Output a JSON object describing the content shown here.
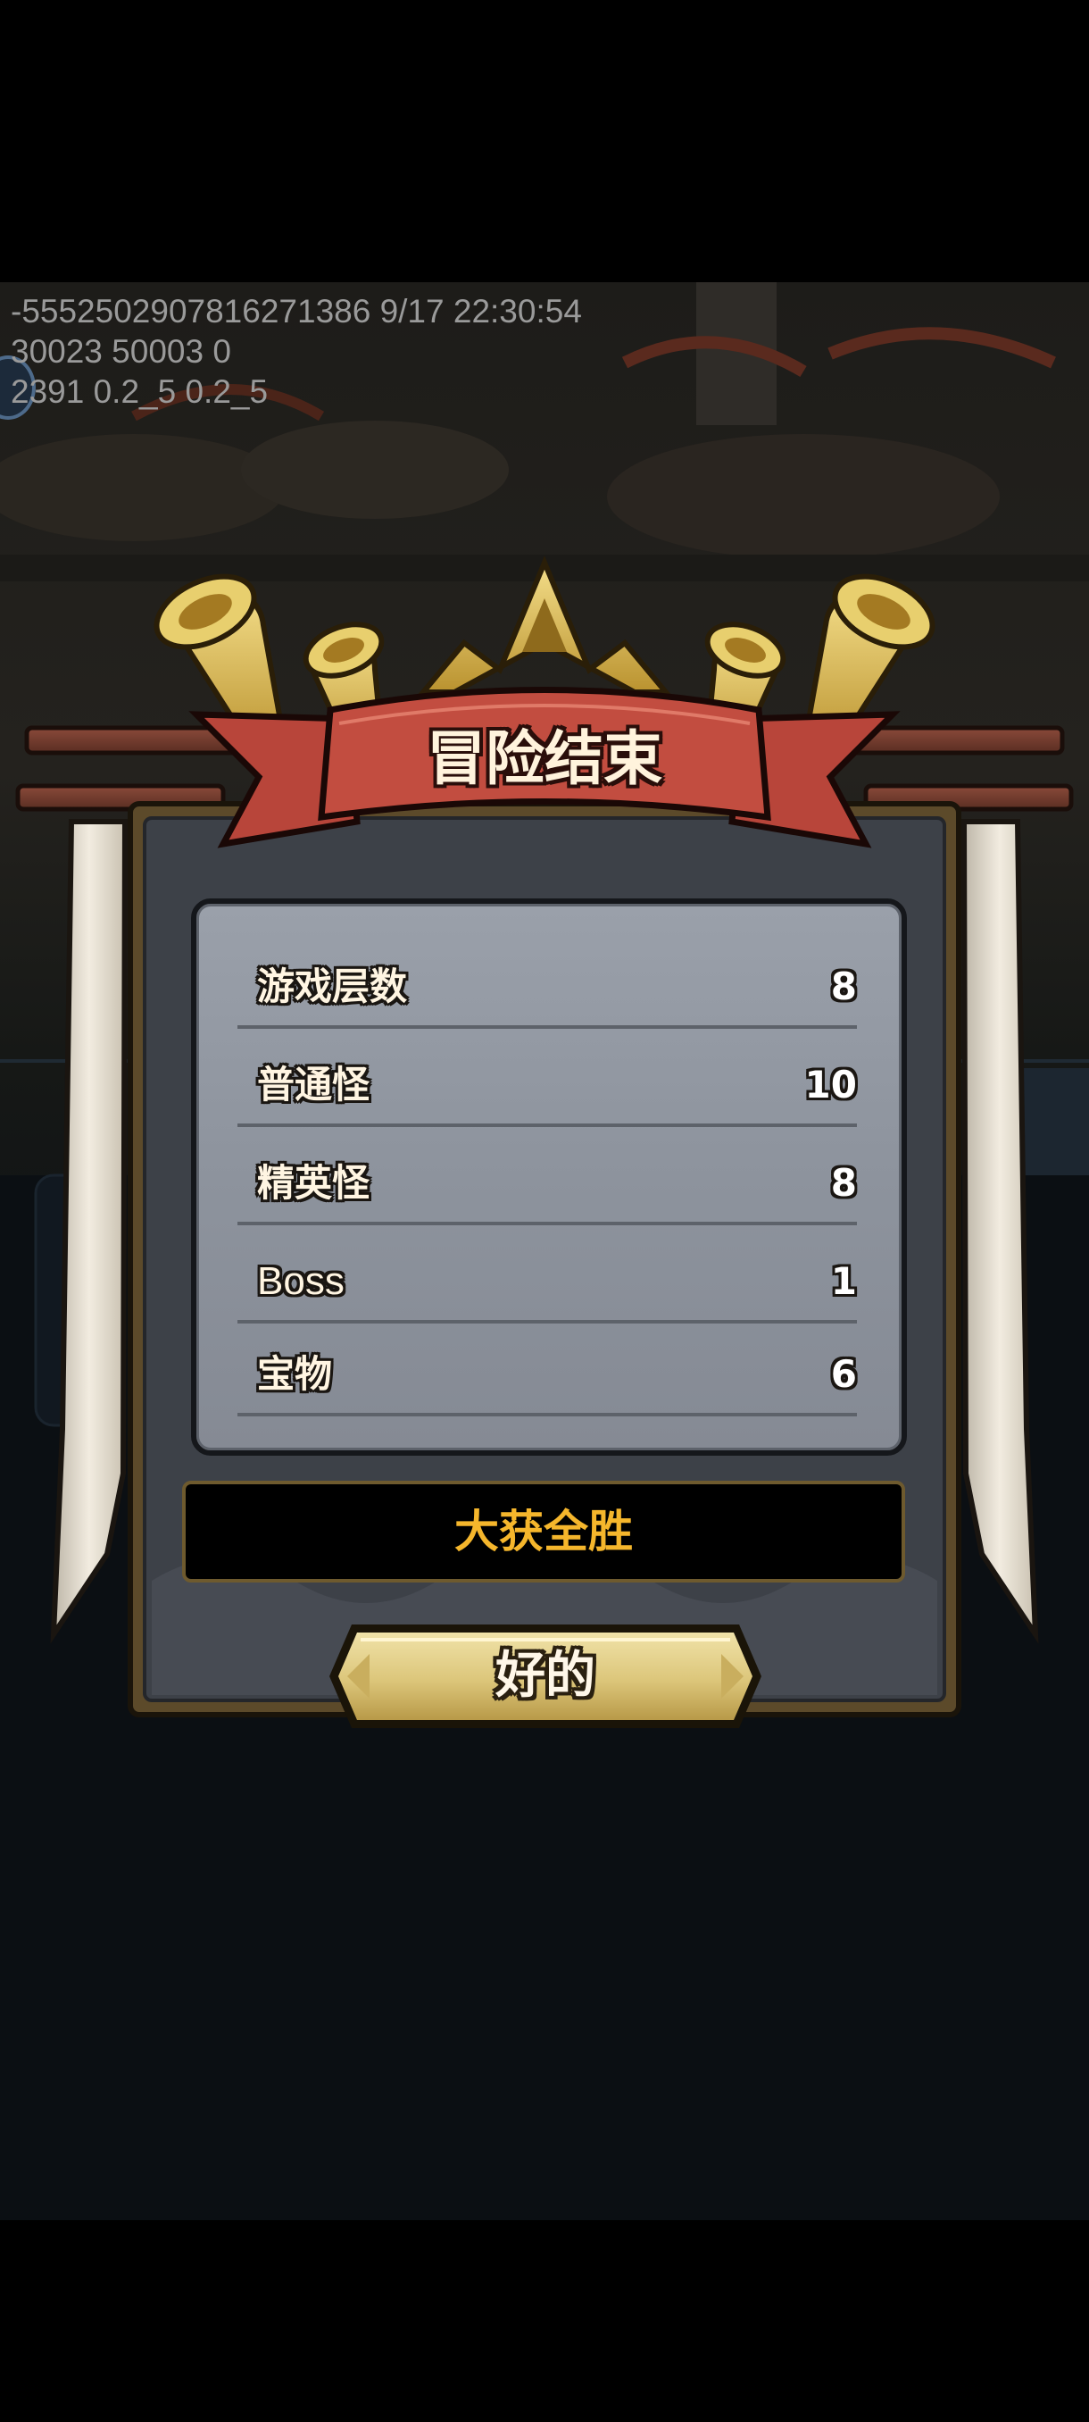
{
  "debug": {
    "line1": "-5552502907816271386 9/17 22:30:54",
    "line2": "30023 50003 0",
    "line3": "2391 0.2_5 0.2_5"
  },
  "dialog": {
    "title": "冒险结束",
    "stats": [
      {
        "label": "游戏层数",
        "value": "8"
      },
      {
        "label": "普通怪",
        "value": "10"
      },
      {
        "label": "精英怪",
        "value": "8"
      },
      {
        "label": "Boss",
        "value": "1"
      },
      {
        "label": "宝物",
        "value": "6"
      }
    ],
    "result": "大获全胜",
    "ok_label": "好的"
  },
  "icons": {
    "left_horns": "golden-horn-icon",
    "crown": "crown-icon",
    "right_horns": "golden-horn-icon"
  },
  "colors": {
    "banner_red": "#b8453a",
    "result_gold": "#f5b62c",
    "button_gold": "#e0c97a",
    "panel_grey": "#8d939d"
  }
}
